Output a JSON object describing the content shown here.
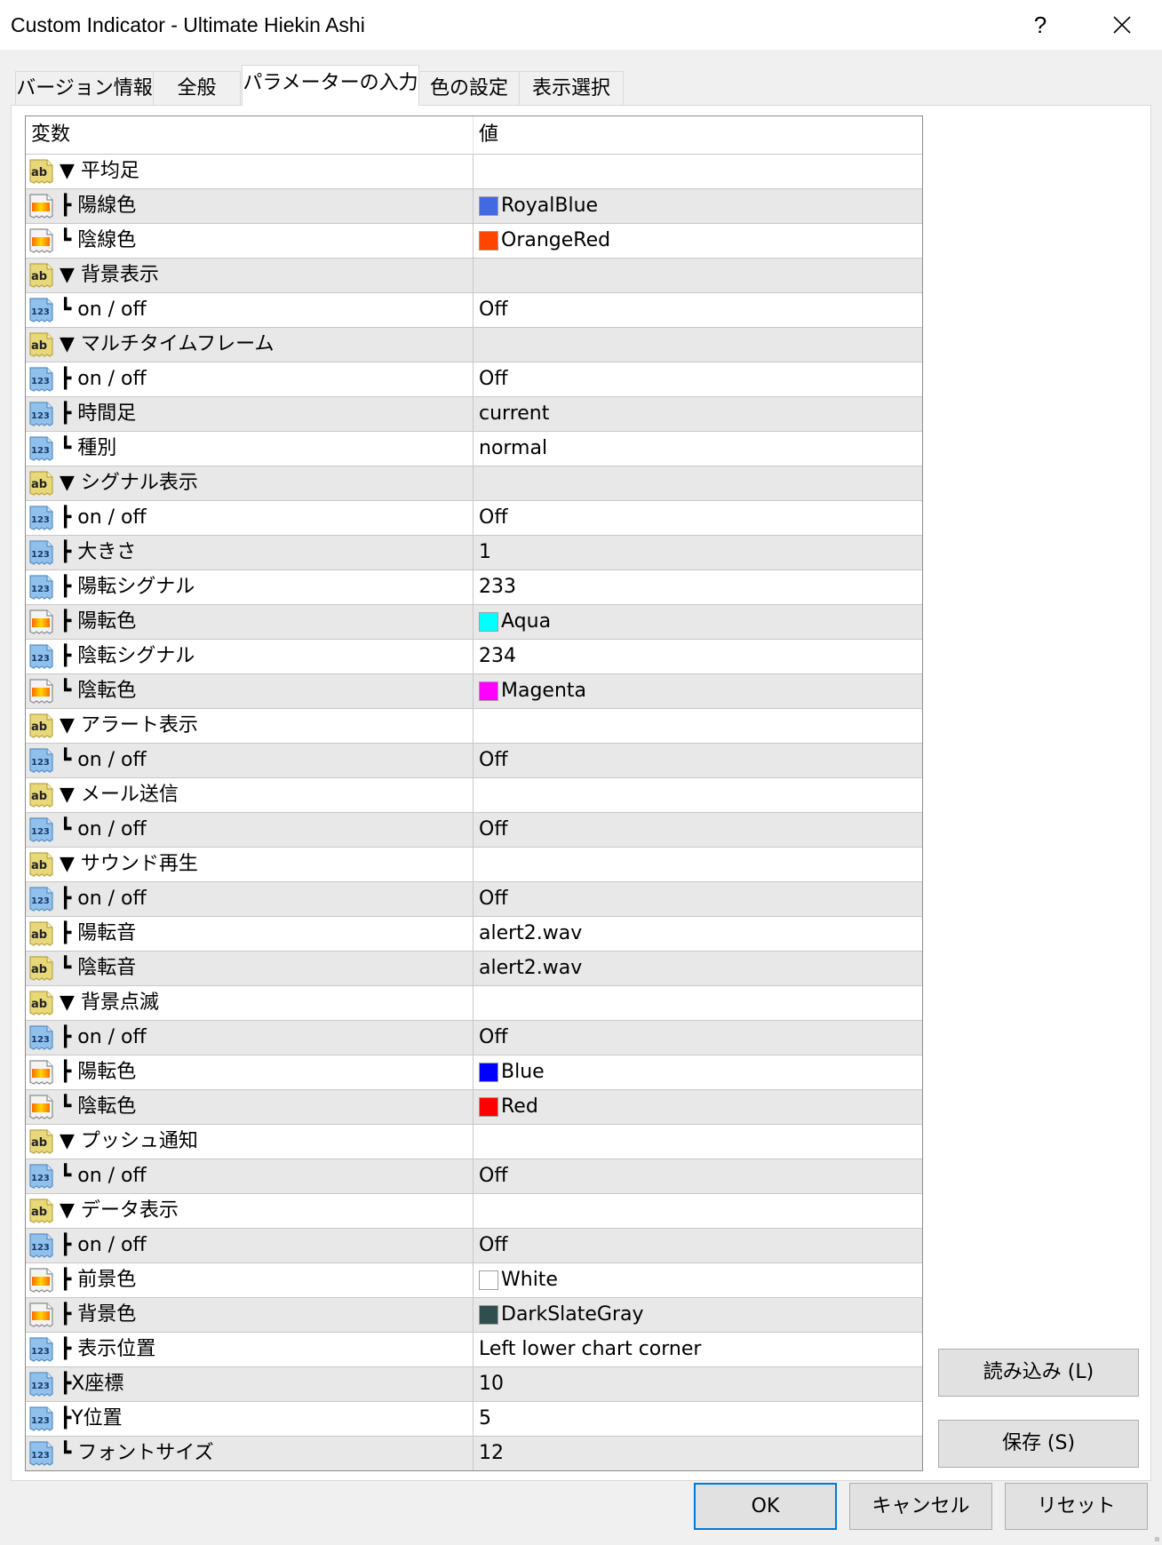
{
  "window": {
    "title": "Custom Indicator - Ultimate Hiekin Ashi",
    "help_label": "?",
    "close_icon": "close-icon"
  },
  "tabs": [
    {
      "label": "バージョン情報",
      "active": false
    },
    {
      "label": "全般",
      "active": false
    },
    {
      "label": "パラメーターの入力",
      "active": true
    },
    {
      "label": "色の設定",
      "active": false
    },
    {
      "label": "表示選択",
      "active": false
    }
  ],
  "grid": {
    "columns": {
      "variable": "変数",
      "value": "値"
    },
    "rows": [
      {
        "icon": "string",
        "name": "▼ 平均足",
        "value": ""
      },
      {
        "icon": "color",
        "name": "┣ 陽線色",
        "value": "RoyalBlue",
        "color": "#4169e1"
      },
      {
        "icon": "color",
        "name": "┗ 陰線色",
        "value": "OrangeRed",
        "color": "#ff4500"
      },
      {
        "icon": "string",
        "name": "▼ 背景表示",
        "value": ""
      },
      {
        "icon": "number",
        "name": "┗ on / off",
        "value": "Off"
      },
      {
        "icon": "string",
        "name": "▼ マルチタイムフレーム",
        "value": ""
      },
      {
        "icon": "number",
        "name": "┣ on / off",
        "value": "Off"
      },
      {
        "icon": "number",
        "name": "┣ 時間足",
        "value": "current"
      },
      {
        "icon": "number",
        "name": "┗ 種別",
        "value": "normal"
      },
      {
        "icon": "string",
        "name": "▼ シグナル表示",
        "value": ""
      },
      {
        "icon": "number",
        "name": "┣ on / off",
        "value": "Off"
      },
      {
        "icon": "number",
        "name": "┣ 大きさ",
        "value": "1"
      },
      {
        "icon": "number",
        "name": "┣ 陽転シグナル",
        "value": "233"
      },
      {
        "icon": "color",
        "name": "┣ 陽転色",
        "value": "Aqua",
        "color": "#00ffff"
      },
      {
        "icon": "number",
        "name": "┣ 陰転シグナル",
        "value": "234"
      },
      {
        "icon": "color",
        "name": "┗ 陰転色",
        "value": "Magenta",
        "color": "#ff00ff"
      },
      {
        "icon": "string",
        "name": "▼ アラート表示",
        "value": ""
      },
      {
        "icon": "number",
        "name": "┗ on / off",
        "value": "Off"
      },
      {
        "icon": "string",
        "name": "▼ メール送信",
        "value": ""
      },
      {
        "icon": "number",
        "name": "┗ on / off",
        "value": "Off"
      },
      {
        "icon": "string",
        "name": "▼ サウンド再生",
        "value": ""
      },
      {
        "icon": "number",
        "name": "┣ on / off",
        "value": "Off"
      },
      {
        "icon": "string",
        "name": "┣ 陽転音",
        "value": "alert2.wav"
      },
      {
        "icon": "string",
        "name": "┗ 陰転音",
        "value": "alert2.wav"
      },
      {
        "icon": "string",
        "name": "▼ 背景点滅",
        "value": ""
      },
      {
        "icon": "number",
        "name": "┣ on / off",
        "value": "Off"
      },
      {
        "icon": "color",
        "name": "┣ 陽転色",
        "value": "Blue",
        "color": "#0000ff"
      },
      {
        "icon": "color",
        "name": "┗ 陰転色",
        "value": "Red",
        "color": "#ff0000"
      },
      {
        "icon": "string",
        "name": "▼ プッシュ通知",
        "value": ""
      },
      {
        "icon": "number",
        "name": "┗ on / off",
        "value": "Off"
      },
      {
        "icon": "string",
        "name": "▼ データ表示",
        "value": ""
      },
      {
        "icon": "number",
        "name": "┣ on / off",
        "value": "Off"
      },
      {
        "icon": "color",
        "name": "┣ 前景色",
        "value": "White",
        "color": "#ffffff"
      },
      {
        "icon": "color",
        "name": "┣ 背景色",
        "value": "DarkSlateGray",
        "color": "#2f4f4f"
      },
      {
        "icon": "number",
        "name": "┣ 表示位置",
        "value": "Left lower chart corner"
      },
      {
        "icon": "number",
        "name": "┣X座標",
        "value": "10"
      },
      {
        "icon": "number",
        "name": "┣Y位置",
        "value": "5"
      },
      {
        "icon": "number",
        "name": "┗ フォントサイズ",
        "value": "12"
      }
    ]
  },
  "side_buttons": {
    "load": "読み込み (L)",
    "save": "保存 (S)"
  },
  "footer_buttons": {
    "ok": "OK",
    "cancel": "キャンセル",
    "reset": "リセット"
  },
  "colors": {
    "focus_border": "#0078d7"
  }
}
